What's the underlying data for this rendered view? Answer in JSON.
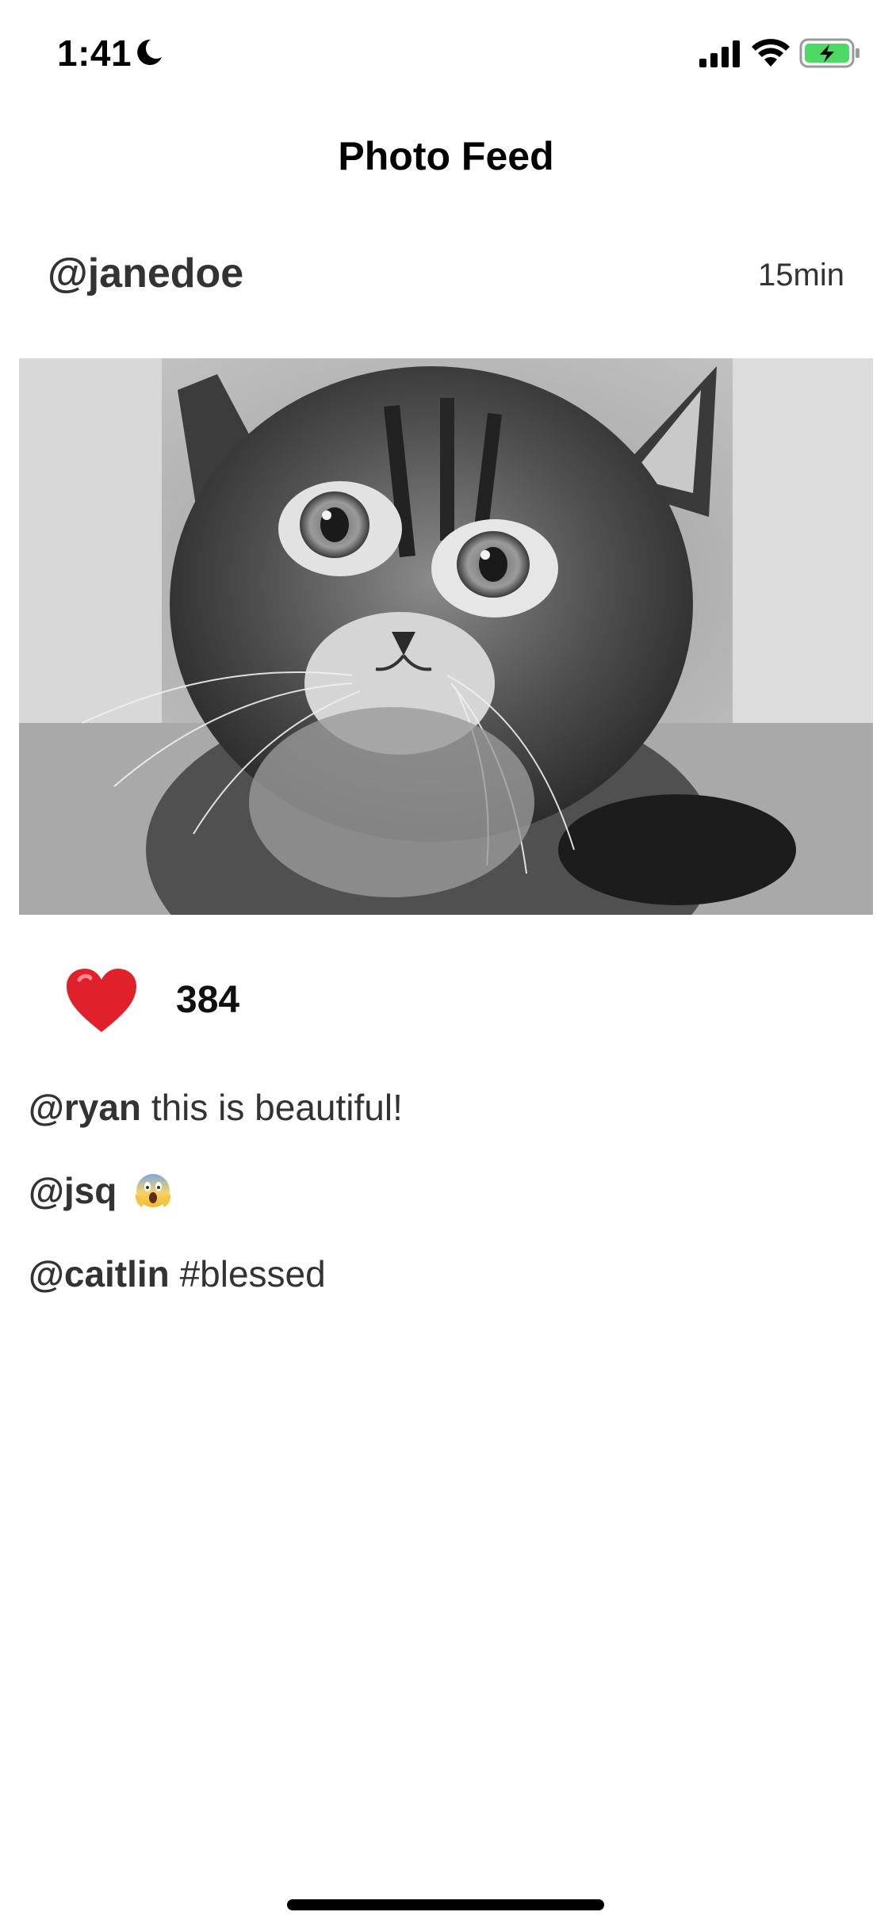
{
  "status_bar": {
    "time": "1:41",
    "icons": [
      "moon-icon",
      "cellular-signal-icon",
      "wifi-icon",
      "battery-charging-icon"
    ],
    "battery_color": "#4cd964"
  },
  "nav": {
    "title": "Photo Feed"
  },
  "post": {
    "user": "@janedoe",
    "time": "15min",
    "photo_icon": "kitten-photo",
    "likes": {
      "icon": "heart-icon",
      "heart_color": "#e0202b",
      "count": "384"
    },
    "comments": [
      {
        "user": "@ryan",
        "text": "this is beautiful!"
      },
      {
        "user": "@jsq",
        "text": "",
        "emoji": "face-screaming-in-fear-icon"
      },
      {
        "user": "@caitlin",
        "text": "#blessed"
      }
    ]
  }
}
